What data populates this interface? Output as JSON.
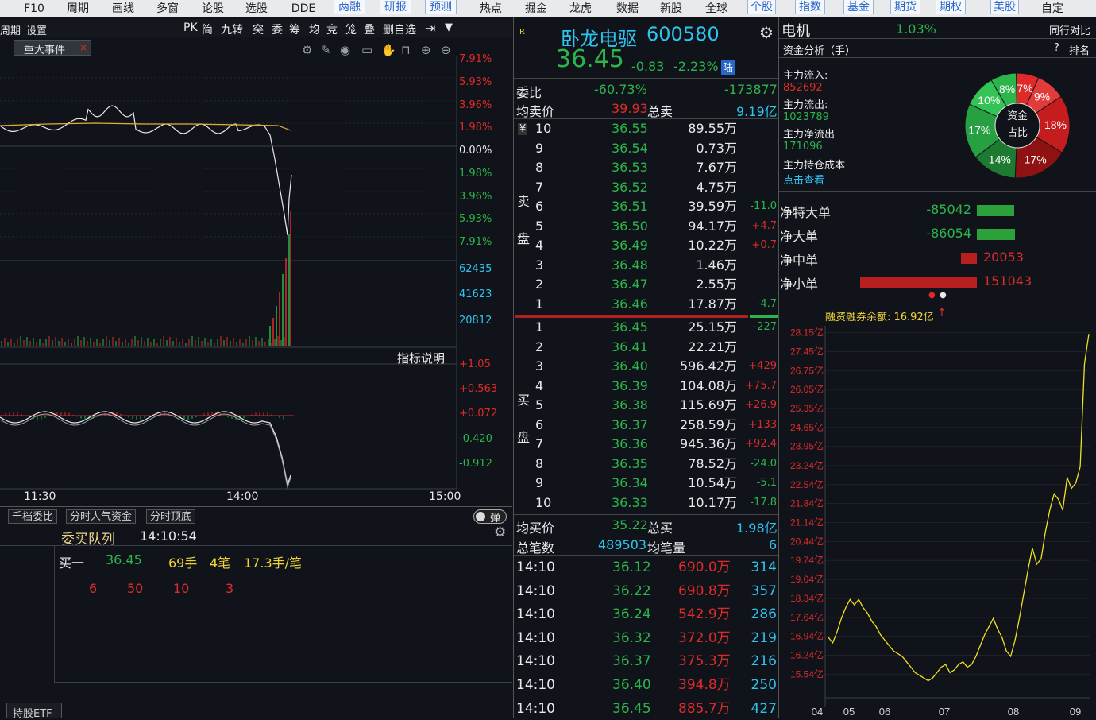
{
  "topnav": [
    "F10",
    "周期",
    "画线",
    "多窗",
    "论股",
    "选股",
    "DDE",
    "两融",
    "研报",
    "预测",
    "热点",
    "掘金",
    "龙虎",
    "数据",
    "新股",
    "全球",
    "个股",
    "指数",
    "基金",
    "期货",
    "期权",
    "美股",
    "自定"
  ],
  "chart_header": {
    "left": [
      "周期",
      "设置"
    ],
    "tools": [
      "PK",
      "简",
      "九转",
      "突",
      "委",
      "筹",
      "均",
      "竞",
      "笼",
      "叠",
      "删自选"
    ],
    "event_tab": "重大事件",
    "event_close": "×"
  },
  "chart_axis": {
    "price_pct": [
      "7.91%",
      "5.93%",
      "3.96%",
      "1.98%",
      "0.00%",
      "1.98%",
      "3.96%",
      "5.93%",
      "7.91%"
    ],
    "volume": [
      "62435",
      "41623",
      "20812"
    ],
    "indicator_label": "指标说明",
    "indicator": [
      "+1.05",
      "+0.563",
      "+0.072",
      "-0.420",
      "-0.912"
    ],
    "time": [
      "11:30",
      "14:00",
      "15:00"
    ]
  },
  "bottom_left": {
    "tabs": [
      "千档委比",
      "分时人气资金",
      "分时顶底"
    ],
    "toggle": "弹",
    "queue_title": "委买队列",
    "queue_time": "14:10:54",
    "buy1": {
      "label": "买一",
      "price": "36.45",
      "lots": "69手",
      "count": "4笔",
      "avg": "17.3手/笔"
    },
    "orders": [
      "6",
      "50",
      "10",
      "3"
    ],
    "etf_tab": "持股ETF"
  },
  "quote": {
    "badge": "R",
    "name": "卧龙电驱",
    "code": "600580",
    "price": "36.45",
    "change": "-0.83",
    "pct": "-2.23%",
    "market_tag": "陆",
    "weibi_label": "委比",
    "weibi_pct": "-60.73%",
    "weibi_val": "-173877",
    "avg_sell_label": "均卖价",
    "avg_sell": "39.93",
    "total_sell_label": "总卖",
    "total_sell": "9.19亿",
    "yen": "¥",
    "sell_label": "卖",
    "pan_label": "盘",
    "buy_label": "买",
    "avg_buy_label": "均买价",
    "avg_buy": "35.22",
    "total_buy_label": "总买",
    "total_buy": "1.98亿",
    "total_deals_label": "总笔数",
    "total_deals": "489503",
    "avg_vol_label": "均笔量",
    "avg_vol": "6"
  },
  "sell_orders": [
    {
      "lvl": "10",
      "price": "36.55",
      "amt": "89.55万",
      "chg": ""
    },
    {
      "lvl": "9",
      "price": "36.54",
      "amt": "0.73万",
      "chg": ""
    },
    {
      "lvl": "8",
      "price": "36.53",
      "amt": "7.67万",
      "chg": ""
    },
    {
      "lvl": "7",
      "price": "36.52",
      "amt": "4.75万",
      "chg": ""
    },
    {
      "lvl": "6",
      "price": "36.51",
      "amt": "39.59万",
      "chg": "-11.0"
    },
    {
      "lvl": "5",
      "price": "36.50",
      "amt": "94.17万",
      "chg": "+4.7"
    },
    {
      "lvl": "4",
      "price": "36.49",
      "amt": "10.22万",
      "chg": "+0.7"
    },
    {
      "lvl": "3",
      "price": "36.48",
      "amt": "1.46万",
      "chg": ""
    },
    {
      "lvl": "2",
      "price": "36.47",
      "amt": "2.55万",
      "chg": ""
    },
    {
      "lvl": "1",
      "price": "36.46",
      "amt": "17.87万",
      "chg": "-4.7"
    }
  ],
  "buy_orders": [
    {
      "lvl": "1",
      "price": "36.45",
      "amt": "25.15万",
      "chg": "-227"
    },
    {
      "lvl": "2",
      "price": "36.41",
      "amt": "22.21万",
      "chg": ""
    },
    {
      "lvl": "3",
      "price": "36.40",
      "amt": "596.42万",
      "chg": "+429"
    },
    {
      "lvl": "4",
      "price": "36.39",
      "amt": "104.08万",
      "chg": "+75.7"
    },
    {
      "lvl": "5",
      "price": "36.38",
      "amt": "115.69万",
      "chg": "+26.9"
    },
    {
      "lvl": "6",
      "price": "36.37",
      "amt": "258.59万",
      "chg": "+133"
    },
    {
      "lvl": "7",
      "price": "36.36",
      "amt": "945.36万",
      "chg": "+92.4"
    },
    {
      "lvl": "8",
      "price": "36.35",
      "amt": "78.52万",
      "chg": "-24.0"
    },
    {
      "lvl": "9",
      "price": "36.34",
      "amt": "10.54万",
      "chg": "-5.1"
    },
    {
      "lvl": "10",
      "price": "36.33",
      "amt": "10.17万",
      "chg": "-17.8"
    }
  ],
  "trades": [
    {
      "t": "14:10",
      "p": "36.12",
      "a": "690.0万",
      "n": "314"
    },
    {
      "t": "14:10",
      "p": "36.22",
      "a": "690.8万",
      "n": "357"
    },
    {
      "t": "14:10",
      "p": "36.24",
      "a": "542.9万",
      "n": "286"
    },
    {
      "t": "14:10",
      "p": "36.32",
      "a": "372.0万",
      "n": "219"
    },
    {
      "t": "14:10",
      "p": "36.37",
      "a": "375.3万",
      "n": "216"
    },
    {
      "t": "14:10",
      "p": "36.40",
      "a": "394.8万",
      "n": "250"
    },
    {
      "t": "14:10",
      "p": "36.45",
      "a": "885.7万",
      "n": "427"
    }
  ],
  "right": {
    "sector": "电机",
    "sector_pct": "1.03%",
    "peer_compare": "同行对比",
    "fund_title": "资金分析（手）",
    "help": "?",
    "rank": "排名",
    "main_in_label": "主力流入:",
    "main_in": "852692",
    "main_out_label": "主力流出:",
    "main_out": "1023789",
    "main_net_label": "主力净流出",
    "main_net": "171096",
    "main_cost_label": "主力持仓成本",
    "click_view": "点击查看",
    "pie_center1": "资金",
    "pie_center2": "占比",
    "margin_label": "融资融券余额: 16.92亿"
  },
  "pie": [
    {
      "v": 8,
      "color": "#2cb54a"
    },
    {
      "v": 7,
      "color": "#e02a2a"
    },
    {
      "v": 9,
      "color": "#e23b3b"
    },
    {
      "v": 18,
      "color": "#c51d1d"
    },
    {
      "v": 17,
      "color": "#8e1212"
    },
    {
      "v": 14,
      "color": "#1f7a31"
    },
    {
      "v": 17,
      "color": "#27a042"
    },
    {
      "v": 10,
      "color": "#34c455"
    }
  ],
  "pie_labels": [
    "8%",
    "7%",
    "9%",
    "18%",
    "17%",
    "14%",
    "17%",
    "10%"
  ],
  "net_orders": [
    {
      "label": "净特大单",
      "value": "-85042",
      "num": -85042
    },
    {
      "label": "净大单",
      "value": "-86054",
      "num": -86054
    },
    {
      "label": "净中单",
      "value": "20053",
      "num": 20053
    },
    {
      "label": "净小单",
      "value": "151043",
      "num": 151043
    }
  ],
  "chart_data": {
    "type": "line",
    "title": "融资融券余额: 16.92亿",
    "yticks": [
      "28.15亿",
      "27.45亿",
      "26.75亿",
      "26.05亿",
      "25.35亿",
      "24.65亿",
      "23.95亿",
      "23.24亿",
      "22.54亿",
      "21.84亿",
      "21.14亿",
      "20.44亿",
      "19.74亿",
      "19.04亿",
      "18.34亿",
      "17.64亿",
      "16.94亿",
      "16.24亿",
      "15.54亿"
    ],
    "xticks": [
      "04",
      "05",
      "06",
      "07",
      "08",
      "09"
    ],
    "ylim": [
      15.2,
      28.4
    ],
    "values": [
      16.9,
      16.7,
      17.1,
      17.6,
      18.0,
      18.3,
      18.1,
      18.3,
      18.0,
      17.8,
      17.5,
      17.3,
      17.0,
      16.8,
      16.6,
      16.4,
      16.3,
      16.2,
      16.0,
      15.8,
      15.6,
      15.5,
      15.4,
      15.3,
      15.4,
      15.6,
      15.8,
      15.9,
      15.6,
      15.7,
      15.9,
      16.0,
      15.8,
      15.9,
      16.2,
      16.6,
      17.0,
      17.3,
      17.6,
      17.2,
      16.9,
      16.4,
      16.2,
      16.8,
      17.6,
      18.5,
      19.4,
      20.2,
      19.6,
      19.8,
      20.8,
      21.6,
      22.2,
      22.0,
      21.6,
      22.8,
      22.4,
      22.6,
      23.2,
      27.0,
      28.1
    ]
  }
}
